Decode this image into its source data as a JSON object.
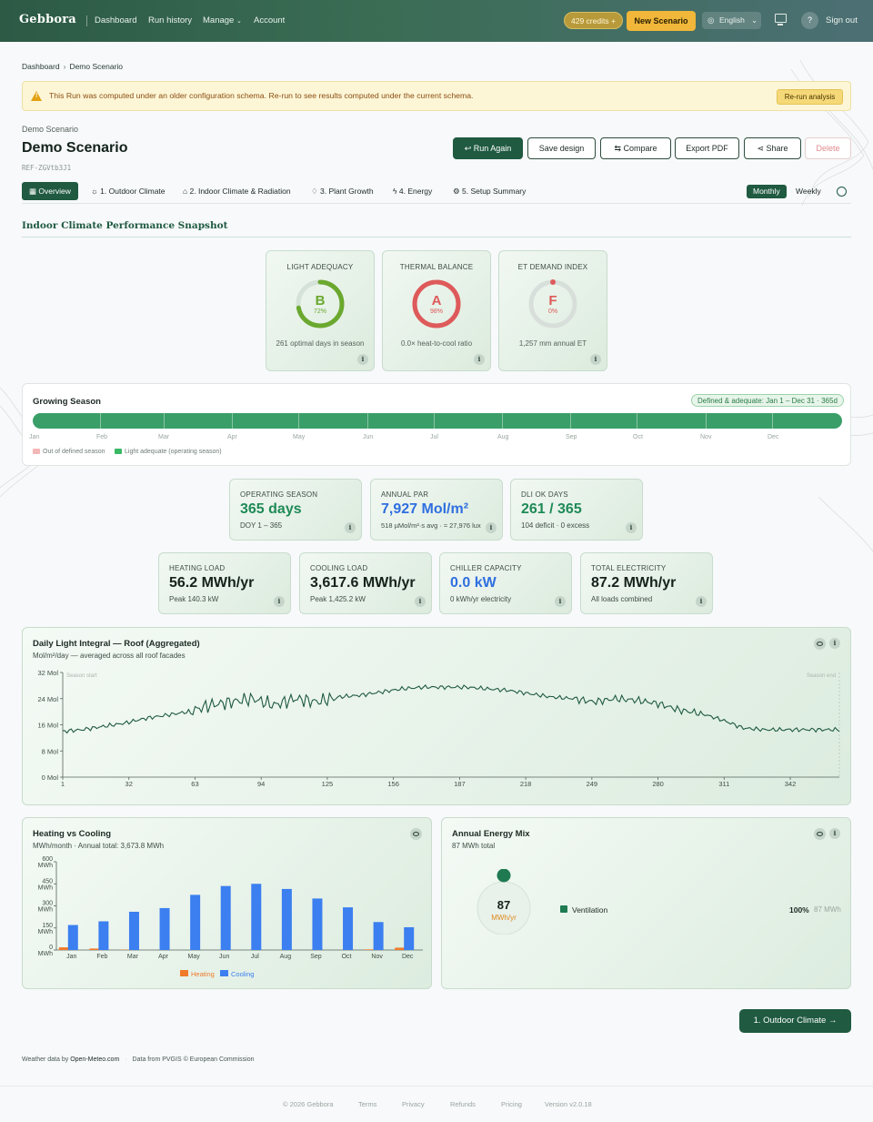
{
  "header": {
    "logo": "Gebbora",
    "nav": [
      "Dashboard",
      "Run history",
      "Manage",
      "Account"
    ],
    "credits": "429 credits",
    "new_scenario": "New Scenario",
    "language": "English",
    "help": "?",
    "sign_out": "Sign out"
  },
  "breadcrumb": {
    "root": "Dashboard",
    "current": "Demo Scenario"
  },
  "banner": {
    "message": "This Run was computed under an older configuration schema. Re-run to see results computed under the current schema.",
    "action": "Re-run analysis",
    "accent": "#e2a213"
  },
  "scenario": {
    "kicker": "Demo Scenario",
    "title": "Demo Scenario",
    "ref": "REF-ZGVtb3J1"
  },
  "actions": {
    "run_again": "Run Again",
    "save_design": "Save design",
    "compare": "Compare",
    "export_pdf": "Export PDF",
    "share": "Share",
    "delete": "Delete"
  },
  "tabs": [
    {
      "label": "Overview",
      "icon": "grid-icon"
    },
    {
      "label": "1. Outdoor Climate",
      "icon": "sun-icon"
    },
    {
      "label": "2. Indoor Climate & Radiation",
      "icon": "house-icon"
    },
    {
      "label": "3. Plant Growth",
      "icon": "leaf-icon"
    },
    {
      "label": "4. Energy",
      "icon": "bolt-icon"
    },
    {
      "label": "5. Setup Summary",
      "icon": "gear-icon"
    }
  ],
  "period_toggle": {
    "monthly": "Monthly",
    "weekly": "Weekly",
    "selected": "Monthly"
  },
  "snapshot": {
    "heading": "Indoor Climate Performance Snapshot",
    "cards": [
      {
        "label": "LIGHT ADEQUACY",
        "grade": "B",
        "pct": "72%",
        "fraction": 0.72,
        "desc": "261 optimal days in season",
        "color": "#6aa82e"
      },
      {
        "label": "THERMAL BALANCE",
        "grade": "A",
        "pct": "98%",
        "fraction": 0.98,
        "desc": "0.0× heat-to-cool ratio",
        "color": "#de5a5a"
      },
      {
        "label": "ET DEMAND INDEX",
        "grade": "F",
        "pct": "0%",
        "fraction": 0.0,
        "desc": "1,257 mm annual ET",
        "color": "#de5a5a"
      }
    ]
  },
  "growing_season": {
    "title": "Growing Season",
    "badge": "Defined & adequate: Jan 1 – Dec 31 · 365d",
    "months": [
      "Jan",
      "Feb",
      "Mar",
      "Apr",
      "May",
      "Jun",
      "Jul",
      "Aug",
      "Sep",
      "Oct",
      "Nov",
      "Dec"
    ],
    "legend_out": "Out of defined season",
    "legend_in": "Light adequate (operating season)",
    "bar_color": "#3a9e68"
  },
  "stats_top": [
    {
      "label": "OPERATING SEASON",
      "value": "365 days",
      "sub": "DOY 1 – 365",
      "color": "#1f8a57"
    },
    {
      "label": "ANNUAL PAR",
      "value": "7,927 Mol/m²",
      "sub": "518 µMol/m²·s avg · ≈ 27,976 lux",
      "color": "#2f6fe0"
    },
    {
      "label": "DLI OK DAYS",
      "value": "261 / 365",
      "sub": "104 deficit · 0 excess",
      "color": "#1f8a57"
    }
  ],
  "stats_bottom": [
    {
      "label": "HEATING LOAD",
      "value": "56.2 MWh/yr",
      "sub": "Peak 140.3 kW",
      "color": "#14221b"
    },
    {
      "label": "COOLING LOAD",
      "value": "3,617.6 MWh/yr",
      "sub": "Peak 1,425.2 kW",
      "color": "#14221b"
    },
    {
      "label": "CHILLER CAPACITY",
      "value": "0.0 kW",
      "sub": "0 kWh/yr electricity",
      "color": "#2f6fe0"
    },
    {
      "label": "TOTAL ELECTRICITY",
      "value": "87.2 MWh/yr",
      "sub": "All loads combined",
      "color": "#14221b"
    }
  ],
  "chart_data": [
    {
      "type": "line",
      "title": "Daily Light Integral — Roof (Aggregated)",
      "subtitle": "Mol/m²/day — averaged across all roof facades",
      "xlabel": "",
      "ylabel": "",
      "xticks": [
        1,
        32,
        63,
        94,
        125,
        156,
        187,
        218,
        249,
        280,
        311,
        342
      ],
      "yticks": [
        "0 Mol",
        "8 Mol",
        "16 Mol",
        "24 Mol",
        "32 Mol"
      ],
      "ylim": [
        0,
        32
      ],
      "xlim": [
        1,
        365
      ],
      "annotations": [
        "Season start",
        "Season end"
      ],
      "series": [
        {
          "x": [
            1,
            10,
            20,
            30,
            40,
            50,
            60,
            70,
            80,
            90,
            100,
            110,
            120,
            130,
            140,
            150,
            160,
            170,
            180,
            190,
            200,
            210,
            220,
            230,
            240,
            250,
            260,
            270,
            280,
            290,
            300,
            310,
            320,
            330,
            340,
            350,
            365
          ],
          "y": [
            14,
            14.5,
            15.5,
            16.5,
            18,
            19,
            20,
            22,
            23,
            24,
            22,
            24,
            23,
            24.5,
            25,
            26,
            27,
            27.5,
            27.5,
            27.5,
            27,
            26.5,
            25.5,
            24.5,
            24,
            23,
            24,
            23.5,
            22.5,
            20.5,
            19.5,
            17.5,
            15,
            14.5,
            14.5,
            14.5,
            14.5
          ]
        }
      ],
      "color": "#1f5a41"
    },
    {
      "type": "bar",
      "title": "Heating vs Cooling",
      "subtitle": "MWh/month · Annual total: 3,673.8 MWh",
      "categories": [
        "Jan",
        "Feb",
        "Mar",
        "Apr",
        "May",
        "Jun",
        "Jul",
        "Aug",
        "Sep",
        "Oct",
        "Nov",
        "Dec"
      ],
      "yticks": [
        "0 MWh",
        "150 MWh",
        "300 MWh",
        "450 MWh",
        "600 MWh"
      ],
      "ylim": [
        0,
        600
      ],
      "series": [
        {
          "name": "Heating",
          "values": [
            18,
            10,
            2,
            0,
            0,
            0,
            0,
            0,
            0,
            0,
            4,
            16
          ],
          "color": "#f07a2a"
        },
        {
          "name": "Cooling",
          "values": [
            170,
            195,
            260,
            285,
            375,
            435,
            450,
            415,
            350,
            290,
            190,
            155
          ],
          "color": "#3b7ff0"
        }
      ]
    },
    {
      "type": "pie",
      "title": "Annual Energy Mix",
      "subtitle": "87 MWh total",
      "center_value": "87",
      "center_unit": "MWh/yr",
      "slices": [
        {
          "name": "Ventilation",
          "percent": "100%",
          "value": "87 MWh",
          "color": "#1f7a52"
        }
      ]
    }
  ],
  "next_step": "1. Outdoor Climate",
  "attribution": {
    "weather": "Weather data by",
    "weather_source": "Open-Meteo.com",
    "pvgis": "Data from PVGIS © European Commission"
  },
  "footer": [
    "© 2026 Gebbora",
    "Terms",
    "Privacy",
    "Refunds",
    "Pricing",
    "Version v2.0.18"
  ]
}
